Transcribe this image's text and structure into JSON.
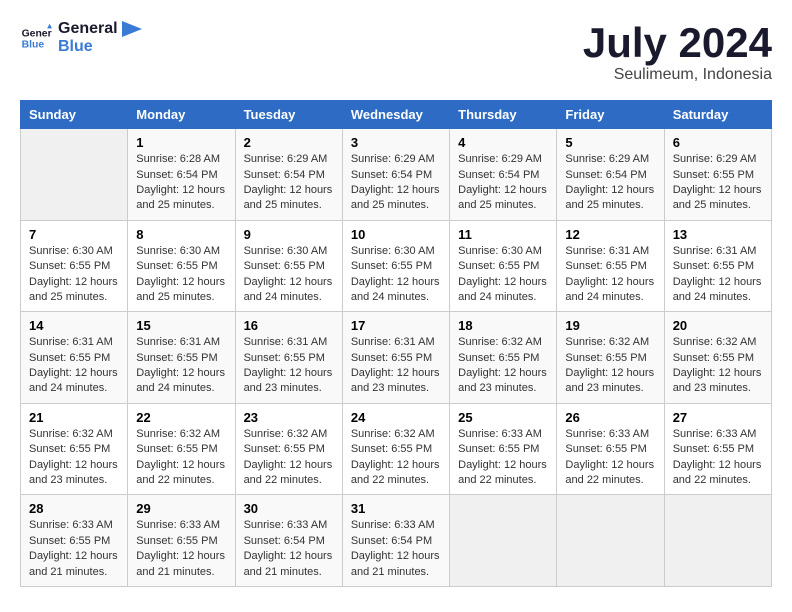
{
  "logo": {
    "line1": "General",
    "line2": "Blue"
  },
  "title": "July 2024",
  "subtitle": "Seulimeum, Indonesia",
  "days_header": [
    "Sunday",
    "Monday",
    "Tuesday",
    "Wednesday",
    "Thursday",
    "Friday",
    "Saturday"
  ],
  "weeks": [
    [
      {
        "day": "",
        "content": ""
      },
      {
        "day": "1",
        "content": "Sunrise: 6:28 AM\nSunset: 6:54 PM\nDaylight: 12 hours\nand 25 minutes."
      },
      {
        "day": "2",
        "content": "Sunrise: 6:29 AM\nSunset: 6:54 PM\nDaylight: 12 hours\nand 25 minutes."
      },
      {
        "day": "3",
        "content": "Sunrise: 6:29 AM\nSunset: 6:54 PM\nDaylight: 12 hours\nand 25 minutes."
      },
      {
        "day": "4",
        "content": "Sunrise: 6:29 AM\nSunset: 6:54 PM\nDaylight: 12 hours\nand 25 minutes."
      },
      {
        "day": "5",
        "content": "Sunrise: 6:29 AM\nSunset: 6:54 PM\nDaylight: 12 hours\nand 25 minutes."
      },
      {
        "day": "6",
        "content": "Sunrise: 6:29 AM\nSunset: 6:55 PM\nDaylight: 12 hours\nand 25 minutes."
      }
    ],
    [
      {
        "day": "7",
        "content": "Sunrise: 6:30 AM\nSunset: 6:55 PM\nDaylight: 12 hours\nand 25 minutes."
      },
      {
        "day": "8",
        "content": "Sunrise: 6:30 AM\nSunset: 6:55 PM\nDaylight: 12 hours\nand 25 minutes."
      },
      {
        "day": "9",
        "content": "Sunrise: 6:30 AM\nSunset: 6:55 PM\nDaylight: 12 hours\nand 24 minutes."
      },
      {
        "day": "10",
        "content": "Sunrise: 6:30 AM\nSunset: 6:55 PM\nDaylight: 12 hours\nand 24 minutes."
      },
      {
        "day": "11",
        "content": "Sunrise: 6:30 AM\nSunset: 6:55 PM\nDaylight: 12 hours\nand 24 minutes."
      },
      {
        "day": "12",
        "content": "Sunrise: 6:31 AM\nSunset: 6:55 PM\nDaylight: 12 hours\nand 24 minutes."
      },
      {
        "day": "13",
        "content": "Sunrise: 6:31 AM\nSunset: 6:55 PM\nDaylight: 12 hours\nand 24 minutes."
      }
    ],
    [
      {
        "day": "14",
        "content": "Sunrise: 6:31 AM\nSunset: 6:55 PM\nDaylight: 12 hours\nand 24 minutes."
      },
      {
        "day": "15",
        "content": "Sunrise: 6:31 AM\nSunset: 6:55 PM\nDaylight: 12 hours\nand 24 minutes."
      },
      {
        "day": "16",
        "content": "Sunrise: 6:31 AM\nSunset: 6:55 PM\nDaylight: 12 hours\nand 23 minutes."
      },
      {
        "day": "17",
        "content": "Sunrise: 6:31 AM\nSunset: 6:55 PM\nDaylight: 12 hours\nand 23 minutes."
      },
      {
        "day": "18",
        "content": "Sunrise: 6:32 AM\nSunset: 6:55 PM\nDaylight: 12 hours\nand 23 minutes."
      },
      {
        "day": "19",
        "content": "Sunrise: 6:32 AM\nSunset: 6:55 PM\nDaylight: 12 hours\nand 23 minutes."
      },
      {
        "day": "20",
        "content": "Sunrise: 6:32 AM\nSunset: 6:55 PM\nDaylight: 12 hours\nand 23 minutes."
      }
    ],
    [
      {
        "day": "21",
        "content": "Sunrise: 6:32 AM\nSunset: 6:55 PM\nDaylight: 12 hours\nand 23 minutes."
      },
      {
        "day": "22",
        "content": "Sunrise: 6:32 AM\nSunset: 6:55 PM\nDaylight: 12 hours\nand 22 minutes."
      },
      {
        "day": "23",
        "content": "Sunrise: 6:32 AM\nSunset: 6:55 PM\nDaylight: 12 hours\nand 22 minutes."
      },
      {
        "day": "24",
        "content": "Sunrise: 6:32 AM\nSunset: 6:55 PM\nDaylight: 12 hours\nand 22 minutes."
      },
      {
        "day": "25",
        "content": "Sunrise: 6:33 AM\nSunset: 6:55 PM\nDaylight: 12 hours\nand 22 minutes."
      },
      {
        "day": "26",
        "content": "Sunrise: 6:33 AM\nSunset: 6:55 PM\nDaylight: 12 hours\nand 22 minutes."
      },
      {
        "day": "27",
        "content": "Sunrise: 6:33 AM\nSunset: 6:55 PM\nDaylight: 12 hours\nand 22 minutes."
      }
    ],
    [
      {
        "day": "28",
        "content": "Sunrise: 6:33 AM\nSunset: 6:55 PM\nDaylight: 12 hours\nand 21 minutes."
      },
      {
        "day": "29",
        "content": "Sunrise: 6:33 AM\nSunset: 6:55 PM\nDaylight: 12 hours\nand 21 minutes."
      },
      {
        "day": "30",
        "content": "Sunrise: 6:33 AM\nSunset: 6:54 PM\nDaylight: 12 hours\nand 21 minutes."
      },
      {
        "day": "31",
        "content": "Sunrise: 6:33 AM\nSunset: 6:54 PM\nDaylight: 12 hours\nand 21 minutes."
      },
      {
        "day": "",
        "content": ""
      },
      {
        "day": "",
        "content": ""
      },
      {
        "day": "",
        "content": ""
      }
    ]
  ]
}
